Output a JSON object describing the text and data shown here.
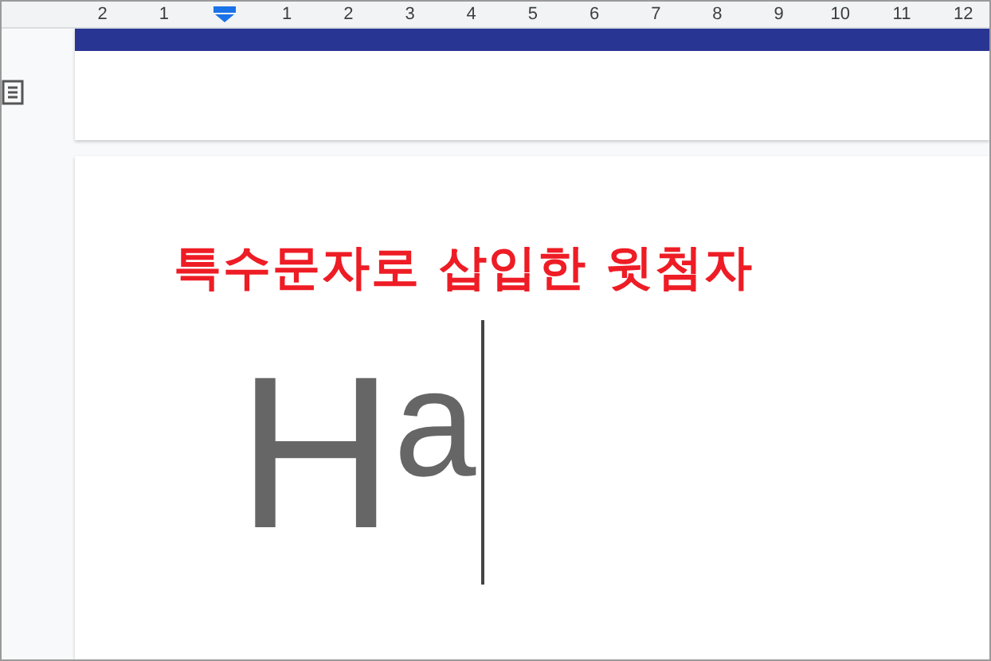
{
  "ruler": {
    "items": [
      {
        "kind": "number",
        "label": "2"
      },
      {
        "kind": "number",
        "label": "1"
      },
      {
        "kind": "indent-marker"
      },
      {
        "kind": "number",
        "label": "1"
      },
      {
        "kind": "number",
        "label": "2"
      },
      {
        "kind": "number",
        "label": "3"
      },
      {
        "kind": "number",
        "label": "4"
      },
      {
        "kind": "number",
        "label": "5"
      },
      {
        "kind": "number",
        "label": "6"
      },
      {
        "kind": "number",
        "label": "7"
      },
      {
        "kind": "number",
        "label": "8"
      },
      {
        "kind": "number",
        "label": "9"
      },
      {
        "kind": "number",
        "label": "10"
      },
      {
        "kind": "number",
        "label": "11"
      },
      {
        "kind": "number",
        "label": "12"
      }
    ]
  },
  "annotation": "특수문자로 삽입한 윗첨자",
  "document": {
    "text": "Hᵃ"
  }
}
